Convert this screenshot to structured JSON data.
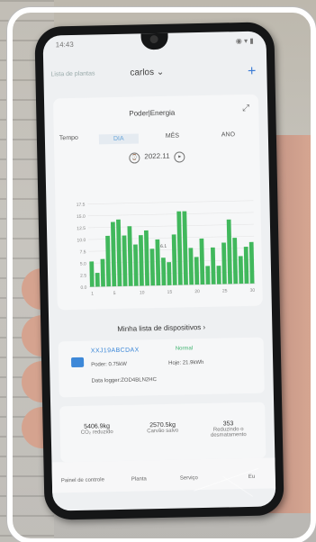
{
  "app": {
    "status_time": "14:43",
    "status_icons": "◉ ▾ ▮",
    "back_label": "Lista de plantas",
    "user": "carlos",
    "user_chevron": "⌄",
    "add": "+",
    "card_title": "Poder|Energia",
    "expand": "⤢",
    "tabs": [
      "Tempo",
      "DIA",
      "MÊS",
      "ANO"
    ],
    "date": "2022.11",
    "chart_y_ticks": [
      "17.5",
      "15.0",
      "12.5",
      "10.0",
      "7.5",
      "5.0",
      "2.5",
      "0.0"
    ],
    "chart_x_ticks": [
      "1",
      "5",
      "10",
      "15",
      "20",
      "25",
      "30"
    ],
    "chart_marker": "6.1",
    "device_list": "Minha lista de dispositivos",
    "device": {
      "name": "XXJ19ABCDAX",
      "state": "Normal",
      "power": "Poder: 0.75kW",
      "today": "Hoje: 21.9kWh",
      "logger": "Data logger:ZOD4BLN2HC"
    },
    "stats": [
      {
        "value": "5406.9kg",
        "label": "CO₂ reduzido"
      },
      {
        "value": "2570.5kg",
        "label": "Carvão salvo"
      },
      {
        "value": "353",
        "label": "Reduzindo o desmatamento"
      }
    ],
    "nav": [
      "Painel de controle",
      "Planta",
      "Serviço",
      "Eu"
    ]
  },
  "chart_data": {
    "type": "bar",
    "x": [
      1,
      2,
      3,
      4,
      5,
      6,
      7,
      8,
      9,
      10,
      11,
      12,
      13,
      14,
      15,
      16,
      17,
      18,
      19,
      20,
      21,
      22,
      23,
      24,
      25,
      26,
      27,
      28,
      29,
      30
    ],
    "values": [
      5.5,
      3,
      6,
      11,
      14,
      14.5,
      11,
      13,
      9,
      11,
      12,
      8,
      10,
      6,
      5,
      11,
      16,
      16,
      8,
      6,
      10,
      4,
      8,
      4,
      9,
      14,
      10,
      6,
      8,
      9
    ],
    "ylim": [
      0,
      18
    ],
    "color": "#41b85c"
  }
}
